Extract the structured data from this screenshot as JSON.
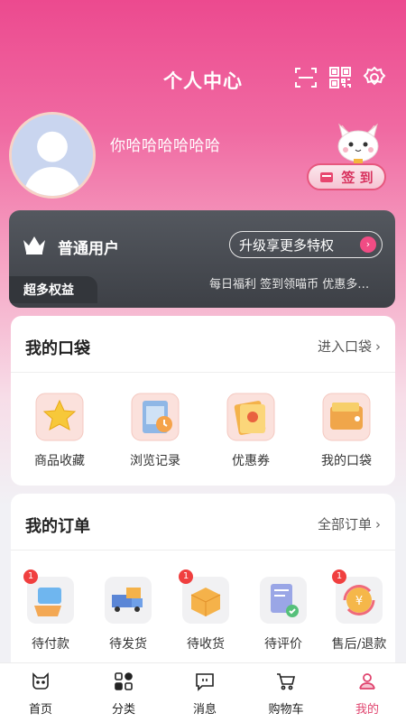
{
  "header": {
    "title": "个人中心",
    "icons": [
      "scan-icon",
      "qrcode-icon",
      "settings-icon"
    ]
  },
  "profile": {
    "username": "你哈哈哈哈哈哈",
    "signin_label": "签 到"
  },
  "vip": {
    "level": "普通用户",
    "upgrade_label": "升级享更多特权",
    "tag": "超多权益",
    "perks": "每日福利 签到领喵币 优惠多…"
  },
  "pocket": {
    "title": "我的口袋",
    "link": "进入口袋",
    "items": [
      {
        "label": "商品收藏",
        "icon": "star-icon"
      },
      {
        "label": "浏览记录",
        "icon": "history-icon"
      },
      {
        "label": "优惠券",
        "icon": "coupon-icon"
      },
      {
        "label": "我的口袋",
        "icon": "wallet-icon"
      }
    ]
  },
  "orders": {
    "title": "我的订单",
    "link": "全部订单",
    "items": [
      {
        "label": "待付款",
        "icon": "pay-icon",
        "badge": "1"
      },
      {
        "label": "待发货",
        "icon": "ship-icon",
        "badge": ""
      },
      {
        "label": "待收货",
        "icon": "receive-icon",
        "badge": "1"
      },
      {
        "label": "待评价",
        "icon": "review-icon",
        "badge": ""
      },
      {
        "label": "售后/退款",
        "icon": "refund-icon",
        "badge": "1"
      }
    ]
  },
  "tabbar": {
    "items": [
      {
        "label": "首页",
        "icon": "home-cat-icon"
      },
      {
        "label": "分类",
        "icon": "category-icon"
      },
      {
        "label": "消息",
        "icon": "message-icon"
      },
      {
        "label": "购物车",
        "icon": "cart-icon"
      },
      {
        "label": "我的",
        "icon": "profile-icon"
      }
    ],
    "active": "我的"
  },
  "colors": {
    "brand_pink": "#ec4a8f",
    "accent_red": "#e0456f",
    "badge_red": "#f03f3f",
    "vip_dark": "#484b51"
  }
}
